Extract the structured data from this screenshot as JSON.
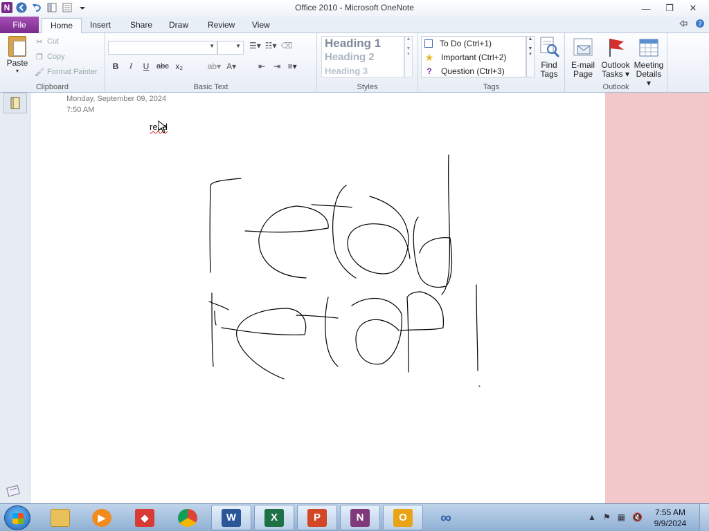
{
  "window": {
    "title": "Office 2010  -  Microsoft OneNote",
    "app_logo": "N",
    "controls": {
      "minimize": "—",
      "restore": "❐",
      "close": "✕"
    }
  },
  "tabs": [
    {
      "label": "File"
    },
    {
      "label": "Home"
    },
    {
      "label": "Insert"
    },
    {
      "label": "Share"
    },
    {
      "label": "Draw"
    },
    {
      "label": "Review"
    },
    {
      "label": "View"
    }
  ],
  "ribbon": {
    "clipboard": {
      "label": "Clipboard",
      "paste": "Paste",
      "cut": "Cut",
      "copy": "Copy",
      "format_painter": "Format Painter"
    },
    "basic_text": {
      "label": "Basic Text",
      "font_value": "",
      "size_value": "",
      "bold": "B",
      "italic": "I",
      "underline": "U",
      "strike": "abc",
      "subscript": "x₂"
    },
    "styles": {
      "label": "Styles",
      "items": [
        "Heading 1",
        "Heading 2",
        "Heading 3"
      ]
    },
    "tags": {
      "label": "Tags",
      "items": [
        "To Do (Ctrl+1)",
        "Important (Ctrl+2)",
        "Question (Ctrl+3)"
      ],
      "find_tags_1": "Find",
      "find_tags_2": "Tags"
    },
    "outlook": {
      "label": "Outlook",
      "email_1": "E-mail",
      "email_2": "Page",
      "tasks_1": "Outlook",
      "tasks_2": "Tasks ▾",
      "meeting_1": "Meeting",
      "meeting_2": "Details ▾"
    }
  },
  "page": {
    "date": "Monday, September  09, 2024",
    "time": "7:50 AM",
    "typed_text": "read"
  },
  "taskbar": {
    "apps": [
      {
        "name": "explorer"
      },
      {
        "name": "media-player"
      },
      {
        "name": "app-red"
      },
      {
        "name": "chrome"
      },
      {
        "name": "word",
        "glyph": "W",
        "color": "#2b5797"
      },
      {
        "name": "excel",
        "glyph": "X",
        "color": "#1e7145"
      },
      {
        "name": "powerpoint",
        "glyph": "P",
        "color": "#d24726"
      },
      {
        "name": "onenote",
        "glyph": "N",
        "color": "#80397b"
      },
      {
        "name": "outlook",
        "glyph": "O",
        "color": "#e8a317"
      },
      {
        "name": "infinity"
      }
    ],
    "clock_time": "7:55 AM",
    "clock_date": "9/9/2024"
  },
  "colors": {
    "file_tab": "#7a2a8c",
    "page_bg": "#ffffff",
    "side_pink": "#f2c8ca",
    "taskbar": "#a9c3e0"
  }
}
